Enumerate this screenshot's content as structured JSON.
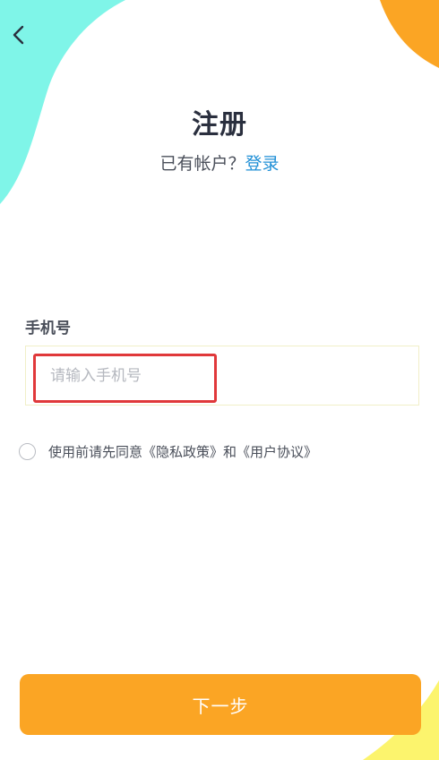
{
  "header": {
    "back_icon": "chevron-left-icon",
    "title": "注册",
    "subtitle_prefix": "已有帐户？",
    "login_link": "登录"
  },
  "form": {
    "phone_label": "手机号",
    "phone_placeholder": "请输入手机号",
    "phone_value": ""
  },
  "agreement": {
    "checked": false,
    "text_prefix": "使用前请先同意",
    "privacy_link": "《隐私政策》",
    "conjunction": "和",
    "terms_link": "《用户协议》"
  },
  "actions": {
    "next_label": "下一步"
  },
  "colors": {
    "accent": "#fba524",
    "link": "#1f8fd6",
    "mint": "#7ff5e8",
    "yellow": "#fcf46d",
    "highlight_border": "#e0383a"
  }
}
